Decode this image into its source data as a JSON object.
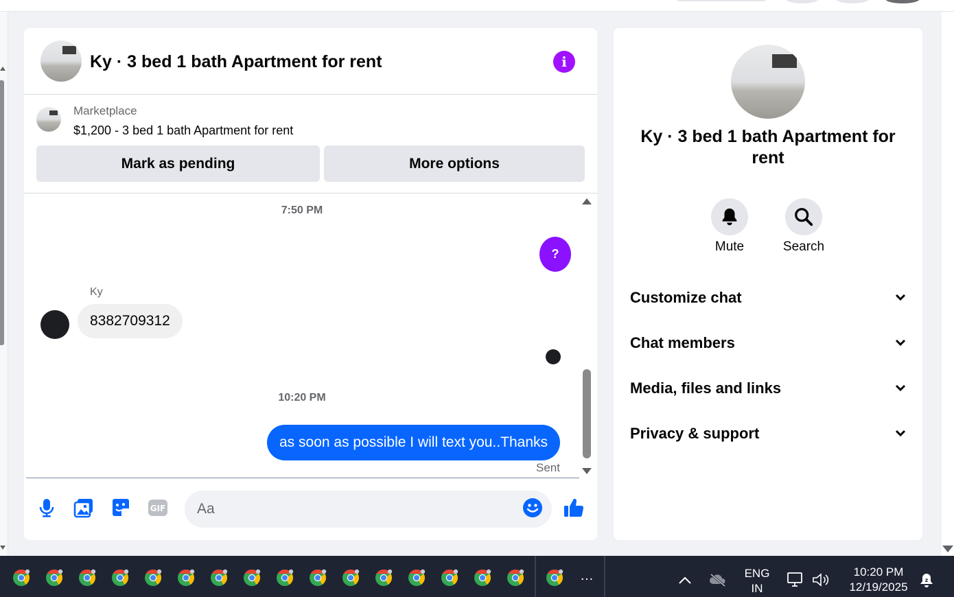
{
  "chat": {
    "title": "Ky · 3 bed 1 bath Apartment for rent",
    "info_icon": "info-icon",
    "listing": {
      "category": "Marketplace",
      "price_title": "$1,200 - 3 bed 1 bath Apartment for rent",
      "mark_pending_label": "Mark as pending",
      "more_options_label": "More options"
    },
    "messages": {
      "time_1": "7:50 PM",
      "outgoing_question": "?",
      "sender_name": "Ky",
      "incoming_text": "8382709312",
      "time_2": "10:20 PM",
      "outgoing_text": "as soon as possible I will text you..Thanks",
      "status": "Sent"
    },
    "composer": {
      "placeholder": "Aa",
      "icons": [
        "microphone-icon",
        "photo-icon",
        "sticker-icon",
        "gif-icon",
        "emoji-icon",
        "thumbs-up-icon"
      ]
    }
  },
  "details_panel": {
    "title": "Ky · 3 bed 1 bath Apartment for rent",
    "actions": [
      {
        "label": "Mute",
        "icon": "bell-icon"
      },
      {
        "label": "Search",
        "icon": "search-icon"
      }
    ],
    "sections": [
      "Customize chat",
      "Chat members",
      "Media, files and links",
      "Privacy & support"
    ]
  },
  "taskbar": {
    "overflow": "…",
    "language": "ENG",
    "region": "IN",
    "time": "10:20 PM",
    "date": "12/19/2025"
  },
  "colors": {
    "accent_blue": "#0866ff",
    "accent_purple": "#a011ff",
    "taskbar_bg": "#1f2433"
  }
}
